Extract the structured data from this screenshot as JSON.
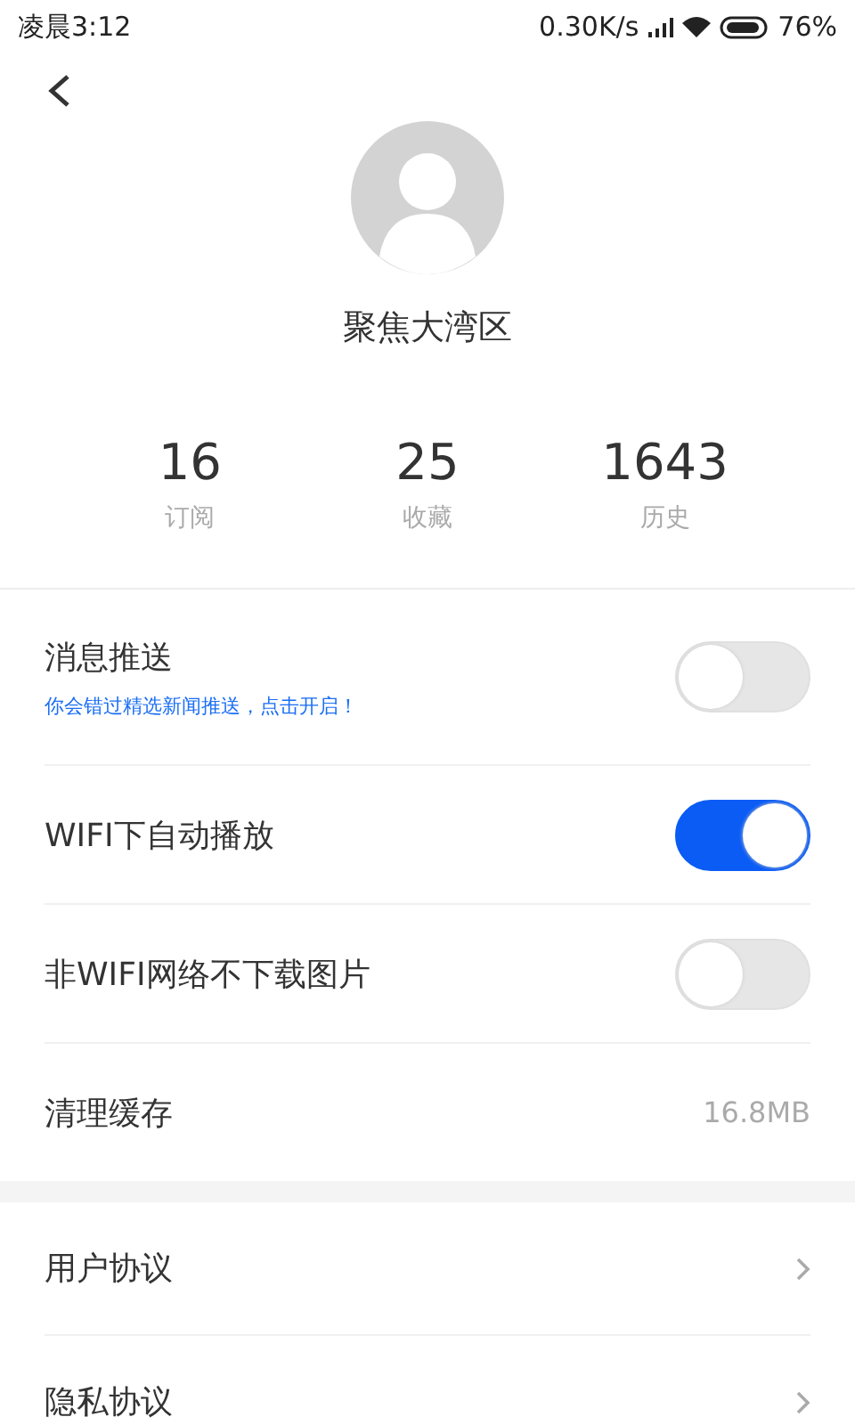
{
  "status_bar": {
    "time": "凌晨3:12",
    "speed": "0.30K/s",
    "battery": "76%"
  },
  "profile": {
    "name": "聚焦大湾区"
  },
  "stats": [
    {
      "value": "16",
      "label": "订阅"
    },
    {
      "value": "25",
      "label": "收藏"
    },
    {
      "value": "1643",
      "label": "历史"
    }
  ],
  "settings": [
    {
      "kind": "toggle",
      "label": "消息推送",
      "hint": "你会错过精选新闻推送，点击开启！",
      "on": false
    },
    {
      "kind": "toggle",
      "label": "WIFI下自动播放",
      "on": true
    },
    {
      "kind": "toggle",
      "label": "非WIFI网络不下载图片",
      "on": false
    },
    {
      "kind": "value",
      "label": "清理缓存",
      "value": "16.8MB"
    }
  ],
  "links": [
    {
      "label": "用户协议"
    },
    {
      "label": "隐私协议"
    }
  ]
}
